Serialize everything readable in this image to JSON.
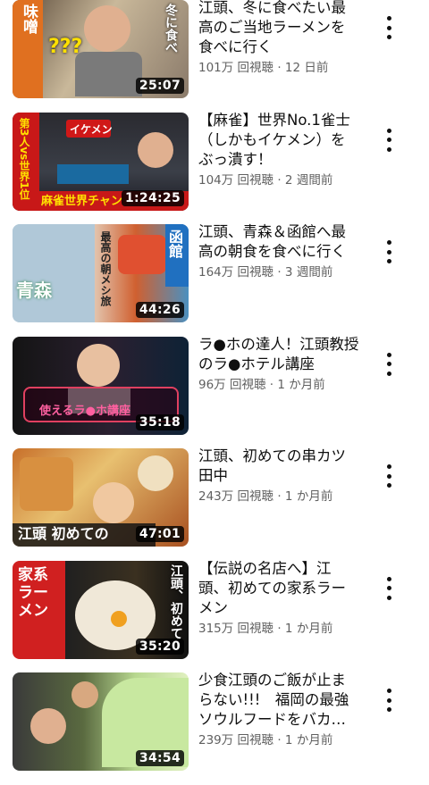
{
  "videos": [
    {
      "title": "江頭、冬に食べたい最高のご当地ラーメンを食べに行く",
      "meta": "101万 回視聴 · 12 日前",
      "duration": "25:07",
      "thumb_text": "味噌??ラーメン",
      "thumb_text_b": "この冬に食べたいソウルフード"
    },
    {
      "title": "【麻雀】世界No.1雀士（しかもイケメン）をぶっ潰す！",
      "meta": "104万 回視聴 · 2 週間前",
      "duration": "1:24:25",
      "thumb_text": "イケメン",
      "thumb_text_b": "麻雀世界チャンピオン"
    },
    {
      "title": "江頭、青森＆函館へ最高の朝食を食べに行く",
      "meta": "164万 回視聴 · 3 週間前",
      "duration": "44:26",
      "thumb_text": "函館",
      "thumb_text_b": "青森"
    },
    {
      "title": "ラ●ホの達人！江頭教授のラ●ホテル講座",
      "meta": "96万 回視聴 · 1 か月前",
      "duration": "35:18",
      "thumb_text": "使えるラ●ホ講座"
    },
    {
      "title": "江頭、初めての串カツ田中",
      "meta": "243万 回視聴 · 1 か月前",
      "duration": "47:01",
      "thumb_text": "江頭 初めての"
    },
    {
      "title": "【伝説の名店へ】江頭、初めての家系ラーメン",
      "meta": "315万 回視聴 · 1 か月前",
      "duration": "35:20",
      "thumb_text": "家系ラーメン",
      "thumb_text_b": "江頭、初めての"
    },
    {
      "title": "少食江頭のご飯が止まらない!!!　福岡の最強ソウルフードをバカ…",
      "meta": "239万 回視聴 · 1 か月前",
      "duration": "34:54"
    }
  ],
  "icons": {
    "more": "three-dot-vertical-icon"
  }
}
